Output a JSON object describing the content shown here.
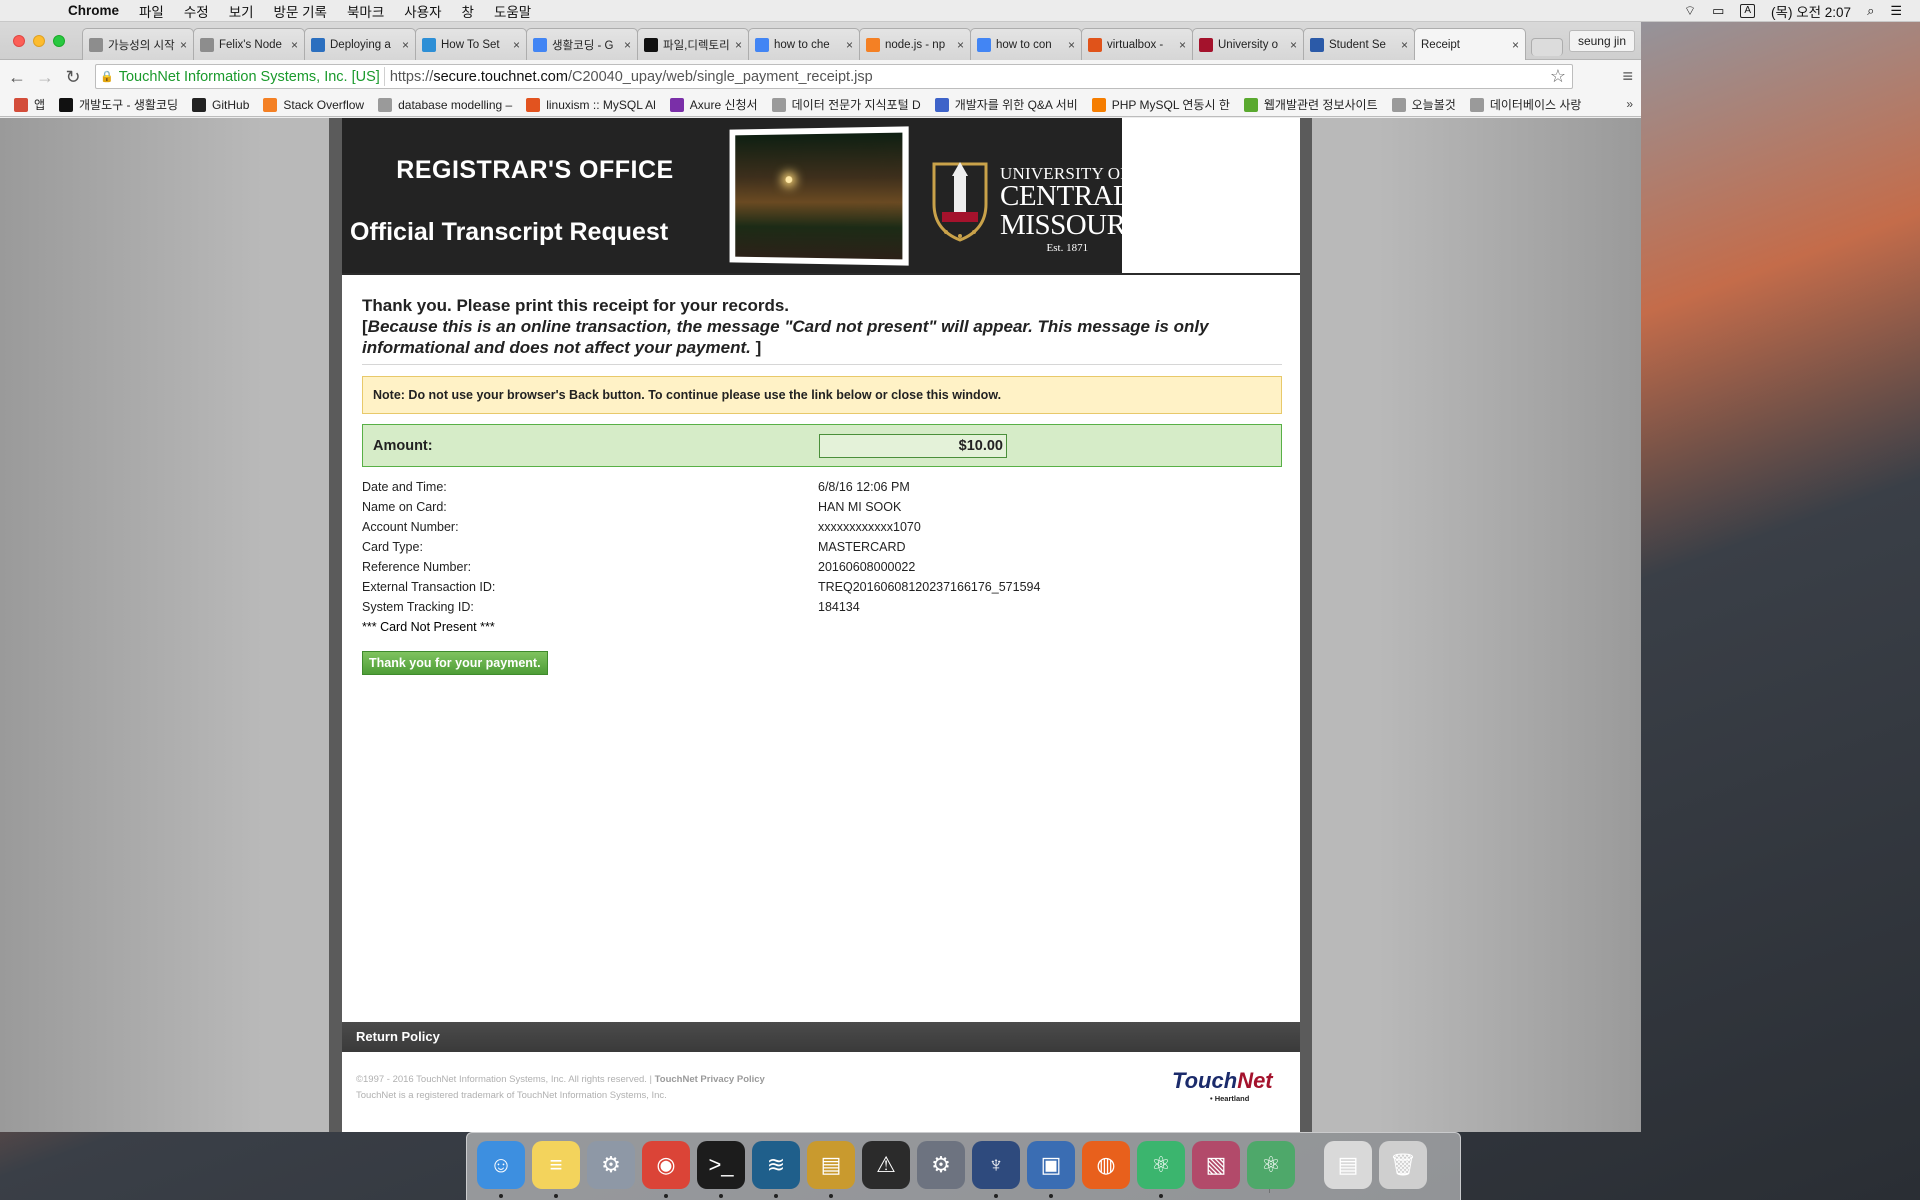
{
  "menubar": {
    "app": "Chrome",
    "items": [
      "파일",
      "수정",
      "보기",
      "방문 기록",
      "북마크",
      "사용자",
      "창",
      "도움말"
    ],
    "clock": "(목) 오전 2:07",
    "input_indicator": "A"
  },
  "browser": {
    "tabs": [
      {
        "title": "가능성의 시작",
        "icon": "page-icon",
        "color": "#8d8d8d"
      },
      {
        "title": "Felix's Node",
        "icon": "page-icon",
        "color": "#8d8d8d"
      },
      {
        "title": "Deploying a",
        "icon": "person-icon",
        "color": "#2b6fbf"
      },
      {
        "title": "How To Set",
        "icon": "cloud-icon",
        "color": "#2d8fd6"
      },
      {
        "title": "생활코딩 - G",
        "icon": "google-icon",
        "color": "#4285f4"
      },
      {
        "title": "파일,디렉토리",
        "icon": "circle-icon",
        "color": "#111111"
      },
      {
        "title": "how to che",
        "icon": "google-icon",
        "color": "#4285f4"
      },
      {
        "title": "node.js - np",
        "icon": "stackoverflow-icon",
        "color": "#f48024"
      },
      {
        "title": "how to con",
        "icon": "google-icon",
        "color": "#4285f4"
      },
      {
        "title": "virtualbox -",
        "icon": "ask-icon",
        "color": "#e0531a"
      },
      {
        "title": "University o",
        "icon": "university-icon",
        "color": "#a4122c"
      },
      {
        "title": "Student Se",
        "icon": "grid-icon",
        "color": "#2b5aa8"
      },
      {
        "title": "Receipt",
        "icon": "",
        "color": "#f5f5f5",
        "active": true
      }
    ],
    "profile": "seung jin",
    "ev_label": "TouchNet Information Systems, Inc. [US]",
    "url_scheme": "https://",
    "url_host": "secure.touchnet.com",
    "url_path": "/C20040_upay/web/single_payment_receipt.jsp",
    "bookmarks": [
      {
        "label": "앱",
        "icon": "apps-icon",
        "color": "#d34d3a"
      },
      {
        "label": "개발도구 - 생활코딩",
        "icon": "circle-icon",
        "color": "#111111"
      },
      {
        "label": "GitHub",
        "icon": "github-icon",
        "color": "#222222"
      },
      {
        "label": "Stack Overflow",
        "icon": "stackoverflow-icon",
        "color": "#f48024"
      },
      {
        "label": "database modelling –",
        "icon": "page-icon",
        "color": "#9a9a9a"
      },
      {
        "label": "linuxism :: MySQL Al",
        "icon": "tistory-icon",
        "color": "#e2531f"
      },
      {
        "label": "Axure 신청서",
        "icon": "axure-icon",
        "color": "#7a2fa8"
      },
      {
        "label": "데이터 전문가 지식포털 D",
        "icon": "page-icon",
        "color": "#9a9a9a"
      },
      {
        "label": "개발자를 위한 Q&A 서비",
        "icon": "okky-icon",
        "color": "#3e63c9"
      },
      {
        "label": "PHP MySQL 연동시 한",
        "icon": "blogger-icon",
        "color": "#f57d00"
      },
      {
        "label": "웹개발관련 정보사이트",
        "icon": "web-icon",
        "color": "#5aa92f"
      },
      {
        "label": "오늘볼것",
        "icon": "page-icon",
        "color": "#9a9a9a"
      },
      {
        "label": "데이터베이스 사랑",
        "icon": "page-icon",
        "color": "#9a9a9a"
      }
    ]
  },
  "banner": {
    "office": "REGISTRAR'S OFFICE",
    "request": "Official Transcript Request",
    "university_line1": "UNIVERSITY OF",
    "university_line2": "CENTRAL",
    "university_line3": "MISSOURI",
    "est": "Est. 1871"
  },
  "receipt": {
    "thanks": "Thank you. Please print this receipt for your records.",
    "disclaimer_open": "[",
    "disclaimer": "Because this is an online transaction, the message \"Card not present\" will appear. This message is only informational and does not affect your payment.",
    "disclaimer_close": " ]",
    "note": "Note: Do not use your browser's Back button. To continue please use the link below or close this window.",
    "amount_label": "Amount:",
    "amount_value": "$10.00",
    "rows": [
      {
        "label": "Date and Time:",
        "value": "6/8/16 12:06 PM"
      },
      {
        "label": "Name on Card:",
        "value": "HAN MI SOOK"
      },
      {
        "label": "Account Number:",
        "value": "xxxxxxxxxxxx1070"
      },
      {
        "label": "Card Type:",
        "value": "MASTERCARD"
      },
      {
        "label": "Reference Number:",
        "value": "20160608000022"
      },
      {
        "label": "External Transaction ID:",
        "value": "TREQ20160608120237166176_571594"
      },
      {
        "label": "System Tracking ID:",
        "value": "184134"
      }
    ],
    "card_not_present": "*** Card Not Present ***",
    "pay_button": "Thank you for your payment."
  },
  "footer": {
    "return_policy": "Return Policy",
    "copyright": "©1997 - 2016 TouchNet Information Systems, Inc. All rights reserved. |",
    "privacy": "TouchNet Privacy Policy",
    "trademark": "TouchNet is a registered trademark of TouchNet Information Systems, Inc.",
    "logo_touch": "Touch",
    "logo_net": "Net",
    "logo_sub": "• Heartland"
  },
  "dock": [
    {
      "name": "finder-icon",
      "color": "#3d8fe0",
      "glyph": "☺",
      "running": true
    },
    {
      "name": "notes-icon",
      "color": "#f3d35c",
      "glyph": "≡",
      "running": true
    },
    {
      "name": "system-preferences-icon",
      "color": "#8e98a6",
      "glyph": "⚙",
      "running": false
    },
    {
      "name": "chrome-icon",
      "color": "#db4437",
      "glyph": "◉",
      "running": true
    },
    {
      "name": "terminal-icon",
      "color": "#1c1c1c",
      "glyph": ">_",
      "running": true
    },
    {
      "name": "mysql-workbench-icon",
      "color": "#1f5f8b",
      "glyph": "≋",
      "running": true
    },
    {
      "name": "sequel-pro-icon",
      "color": "#c99a2e",
      "glyph": "▤",
      "running": true
    },
    {
      "name": "console-icon",
      "color": "#2b2b2b",
      "glyph": "⚠",
      "running": false
    },
    {
      "name": "disk-utility-icon",
      "color": "#6d7380",
      "glyph": "⚙",
      "running": false
    },
    {
      "name": "sourcetree-icon",
      "color": "#2e4a7d",
      "glyph": "♆",
      "running": true
    },
    {
      "name": "virtualbox-icon",
      "color": "#3a6db3",
      "glyph": "▣",
      "running": true
    },
    {
      "name": "firefox-icon",
      "color": "#e8601c",
      "glyph": "◍",
      "running": false
    },
    {
      "name": "atom-icon",
      "color": "#3bb56e",
      "glyph": "⚛",
      "running": true
    },
    {
      "name": "photo-icon",
      "color": "#b24a6a",
      "glyph": "▧",
      "running": false
    },
    {
      "name": "atom-download-icon",
      "color": "#4ea86a",
      "glyph": "⚛",
      "running": false
    },
    {
      "name": "documents-stack-icon",
      "color": "#d9d9d9",
      "glyph": "▤",
      "running": false
    },
    {
      "name": "trash-icon",
      "color": "#cfcfcf",
      "glyph": "🗑",
      "running": false
    }
  ]
}
